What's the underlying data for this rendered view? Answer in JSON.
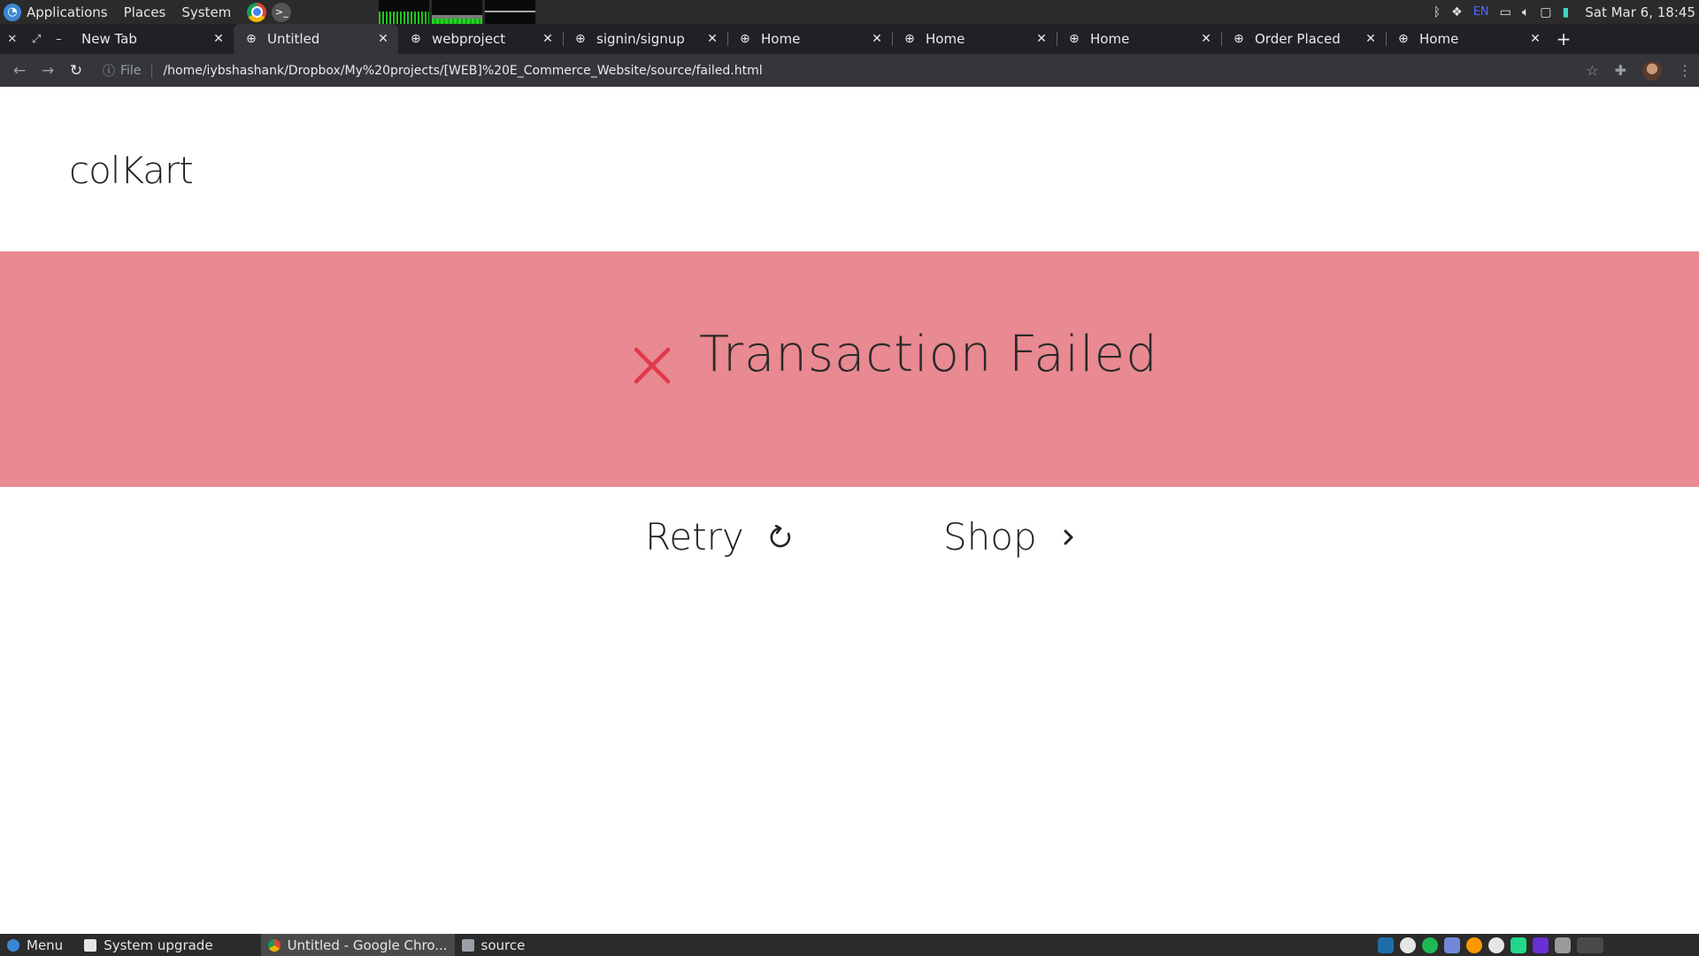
{
  "system_panel": {
    "menus": [
      "Applications",
      "Places",
      "System"
    ],
    "tray_lang": "EN",
    "clock": "Sat Mar 6, 18:45"
  },
  "browser": {
    "tabs": [
      {
        "title": "New Tab"
      },
      {
        "title": "Untitled",
        "active": true
      },
      {
        "title": "webproject"
      },
      {
        "title": "signin/signup"
      },
      {
        "title": "Home"
      },
      {
        "title": "Home"
      },
      {
        "title": "Home"
      },
      {
        "title": "Order Placed"
      },
      {
        "title": "Home"
      }
    ],
    "address": {
      "scheme_label": "File",
      "url": "/home/iybshashank/Dropbox/My%20projects/[WEB]%20E_Commerce_Website/source/failed.html"
    }
  },
  "page": {
    "brand": "colKart",
    "status_message": "Transaction Failed",
    "status_icon": "close-x-icon",
    "retry_label": "Retry",
    "shop_label": "Shop",
    "colors": {
      "banner": "#e98991",
      "fail_icon": "#e03a4a"
    }
  },
  "taskbar": {
    "menu_label": "Menu",
    "items": [
      {
        "label": "System upgrade"
      },
      {
        "label": "Untitled - Google Chro...",
        "active": true
      },
      {
        "label": "source"
      }
    ]
  }
}
